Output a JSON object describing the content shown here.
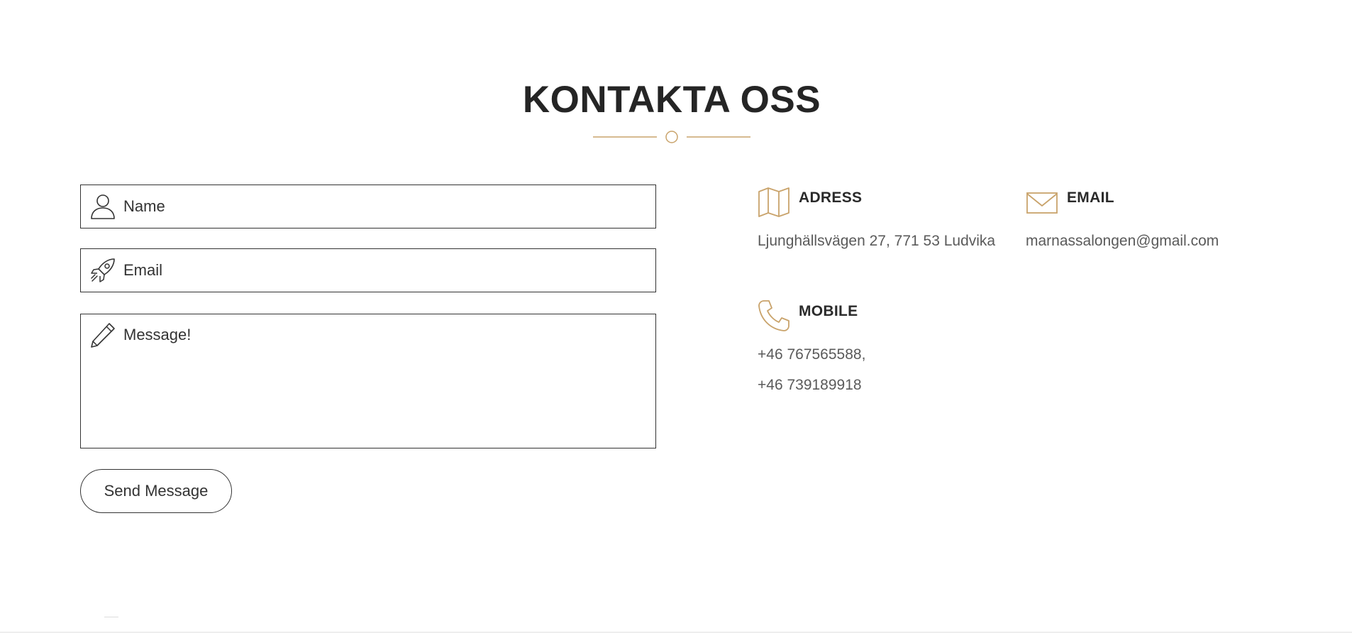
{
  "page": {
    "title": "KONTAKTA OSS",
    "accent_color": "#c9a36b"
  },
  "form": {
    "name_placeholder": "Name",
    "email_placeholder": "Email",
    "message_placeholder": "Message!",
    "name_icon": "user-icon",
    "email_icon": "rocket-icon",
    "message_icon": "pencil-icon",
    "send_label": "Send Message"
  },
  "contact": {
    "address": {
      "icon": "map-icon",
      "heading": "ADRESS",
      "text": "Ljunghällsvägen 27, 771 53 Ludvika"
    },
    "email": {
      "icon": "envelope-icon",
      "heading": "EMAIL",
      "text": "marnassalongen@gmail.com"
    },
    "mobile": {
      "icon": "phone-icon",
      "heading": "MOBILE",
      "lines": [
        "+46 767565588,",
        "+46 739189918"
      ]
    }
  }
}
